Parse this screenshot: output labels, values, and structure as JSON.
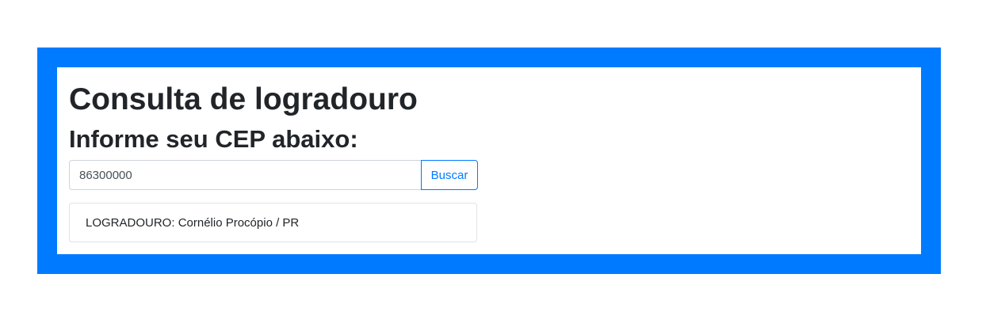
{
  "colors": {
    "frame": "#007bff",
    "panel": "#ffffff",
    "accent": "#007bff",
    "text": "#212529"
  },
  "page": {
    "title": "Consulta de logradouro",
    "subtitle": "Informe seu CEP abaixo:"
  },
  "search": {
    "cep_value": "86300000",
    "button_label": "Buscar"
  },
  "result": {
    "label": "LOGRADOURO:",
    "value": "Cornélio Procópio / PR"
  }
}
